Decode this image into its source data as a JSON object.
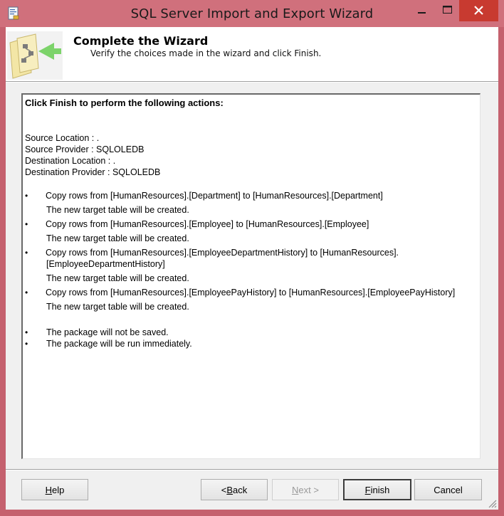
{
  "window": {
    "title": "SQL Server Import and Export Wizard",
    "frame_color": "#c5616e",
    "close_color": "#c83a30"
  },
  "header": {
    "title": "Complete the Wizard",
    "subtitle": "Verify the choices made in the wizard and click Finish."
  },
  "summary": {
    "heading": "Click Finish to perform the following actions:",
    "connection_lines": [
      "Source Location : .",
      "Source Provider : SQLOLEDB",
      "Destination Location : .",
      "Destination Provider : SQLOLEDB"
    ],
    "actions": [
      {
        "bullet": "•",
        "text": "Copy rows from [HumanResources].[Department] to [HumanResources].[Department]",
        "note": "The new target table will be created."
      },
      {
        "bullet": "•",
        "text": "Copy rows from [HumanResources].[Employee] to [HumanResources].[Employee]",
        "note": "The new target table will be created."
      },
      {
        "bullet": "•",
        "text": "Copy rows from [HumanResources].[EmployeeDepartmentHistory] to [HumanResources].",
        "text_cont": "[EmployeeDepartmentHistory]",
        "note": "The new target table will be created."
      },
      {
        "bullet": "•",
        "text": "Copy rows from [HumanResources].[EmployeePayHistory] to [HumanResources].[EmployeePayHistory]",
        "note": "The new target table will be created."
      }
    ],
    "package_notes": [
      {
        "bullet": "•",
        "text": "The package will not be saved."
      },
      {
        "bullet": "•",
        "text": "The package will be run immediately."
      }
    ]
  },
  "buttons": {
    "help": {
      "pre": "",
      "u": "H",
      "post": "elp"
    },
    "back": {
      "pre": "< ",
      "u": "B",
      "post": "ack"
    },
    "next": {
      "pre": "",
      "u": "N",
      "post": "ext >"
    },
    "finish": {
      "pre": "",
      "u": "F",
      "post": "inish"
    },
    "cancel": {
      "pre": "Cancel",
      "u": "",
      "post": ""
    }
  }
}
